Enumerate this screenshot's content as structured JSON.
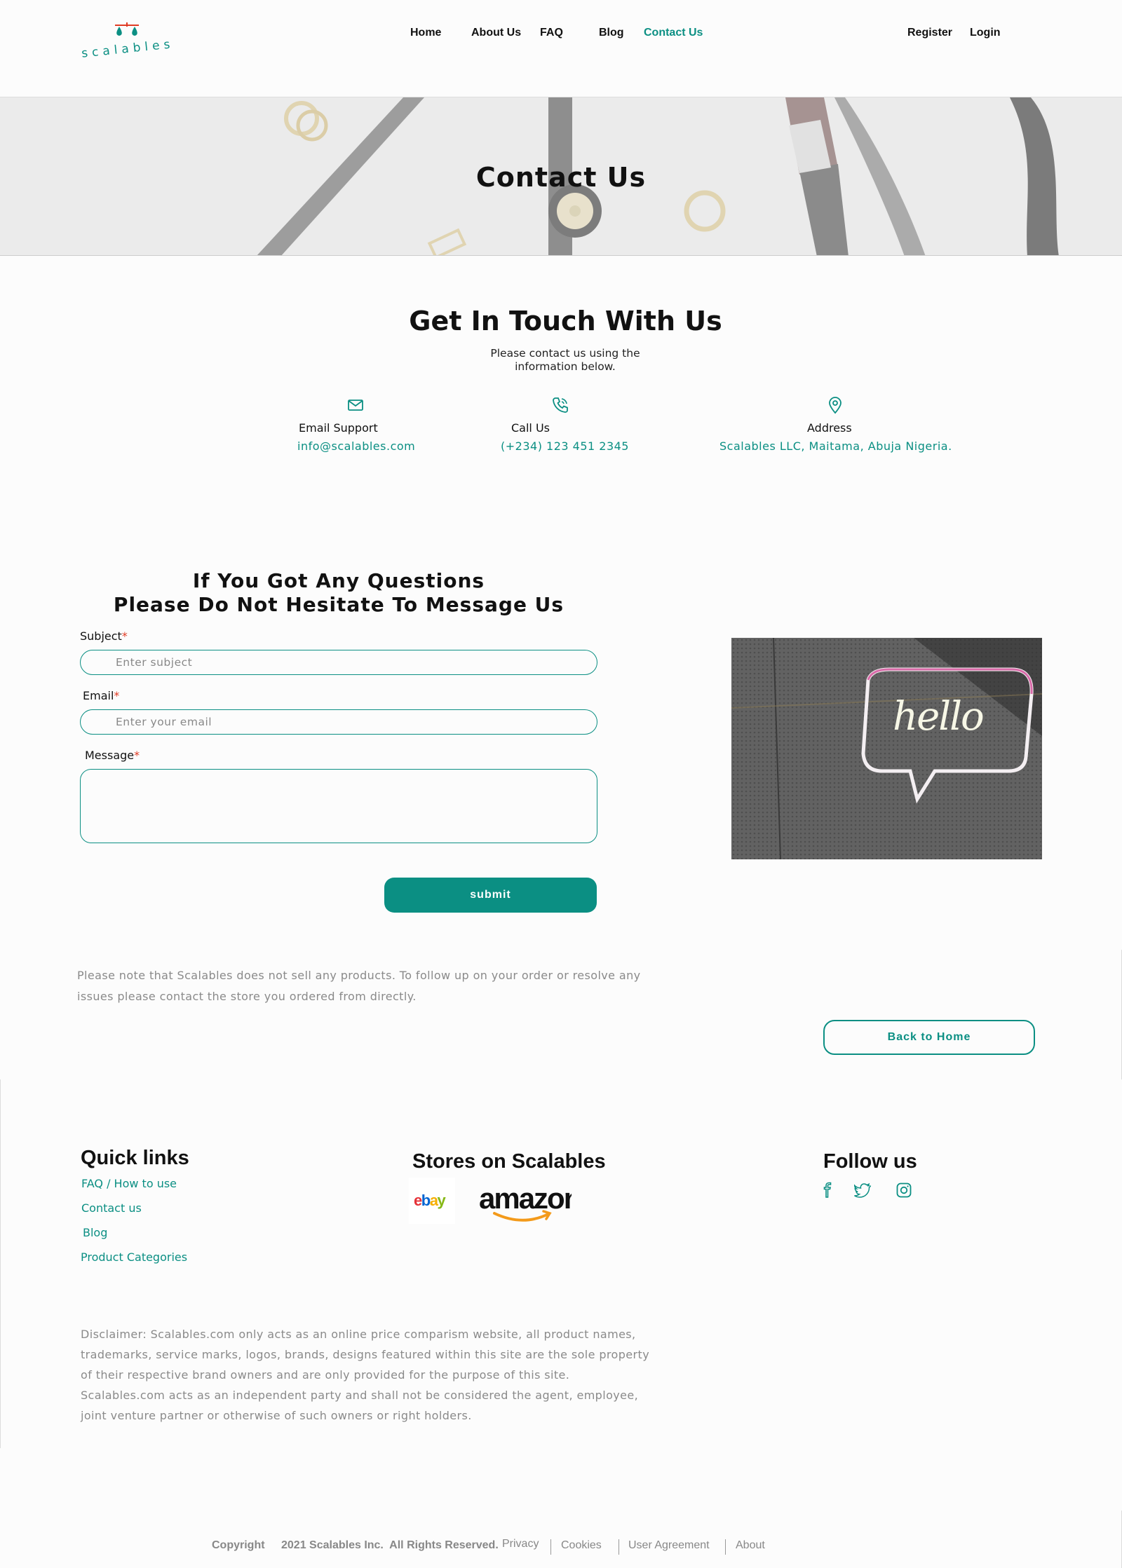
{
  "brand": {
    "name": "scalables",
    "accent": "#0b8f83"
  },
  "nav": {
    "links": [
      "Home",
      "About Us",
      "FAQ",
      "Blog",
      "Contact Us"
    ],
    "active": "Contact Us",
    "register": "Register",
    "login": "Login"
  },
  "hero": {
    "title": "Contact Us"
  },
  "touch": {
    "title": "Get In Touch With Us",
    "subtitle": "Please contact us using the information below.",
    "email": {
      "icon": "mail-icon",
      "label": "Email Support",
      "value": "info@scalables.com"
    },
    "call": {
      "icon": "phone-icon",
      "label": "Call Us",
      "value": "(+234) 123 451 2345"
    },
    "address": {
      "icon": "map-pin-icon",
      "label": "Address",
      "value": "Scalables LLC, Maitama, Abuja Nigeria."
    }
  },
  "form": {
    "title_line1": "If You Got Any Questions",
    "title_line2": "Please Do Not Hesitate To Message Us",
    "subject_label": "Subject",
    "subject_placeholder": "Enter subject",
    "email_label": "Email",
    "email_placeholder": "Enter your email",
    "message_label": "Message",
    "required_mark": "*",
    "submit": "submit"
  },
  "side_image": {
    "text": "hello"
  },
  "note": "Please note that Scalables does not sell any products. To follow up on your order or resolve any issues please contact the store you ordered from directly.",
  "back_home": "Back to Home",
  "footer": {
    "quick_links_title": "Quick links",
    "quick_links": [
      "FAQ / How to use",
      "Contact us",
      "Blog",
      "Product Categories"
    ],
    "stores_title": "Stores on Scalables",
    "stores": [
      "ebay",
      "amazon"
    ],
    "follow_title": "Follow us",
    "social": [
      "facebook-icon",
      "twitter-icon",
      "instagram-icon"
    ],
    "disclaimer_1": "Disclaimer: Scalables.com only acts as an online price comparism website, all product names, trademarks, service marks, logos, brands, designs featured within this site are the sole property of their respective brand owners and are only provided for the purpose of this site.",
    "disclaimer_2": "Scalables.com acts as an independent party and shall not be considered the agent, employee, joint venture partner or otherwise of such owners or right holders."
  },
  "bottom": {
    "copyright": "Copyright",
    "rights": "2021 Scalables Inc.  All Rights Reserved.",
    "links": [
      "Privacy",
      "Cookies",
      "User Agreement",
      "About"
    ]
  }
}
